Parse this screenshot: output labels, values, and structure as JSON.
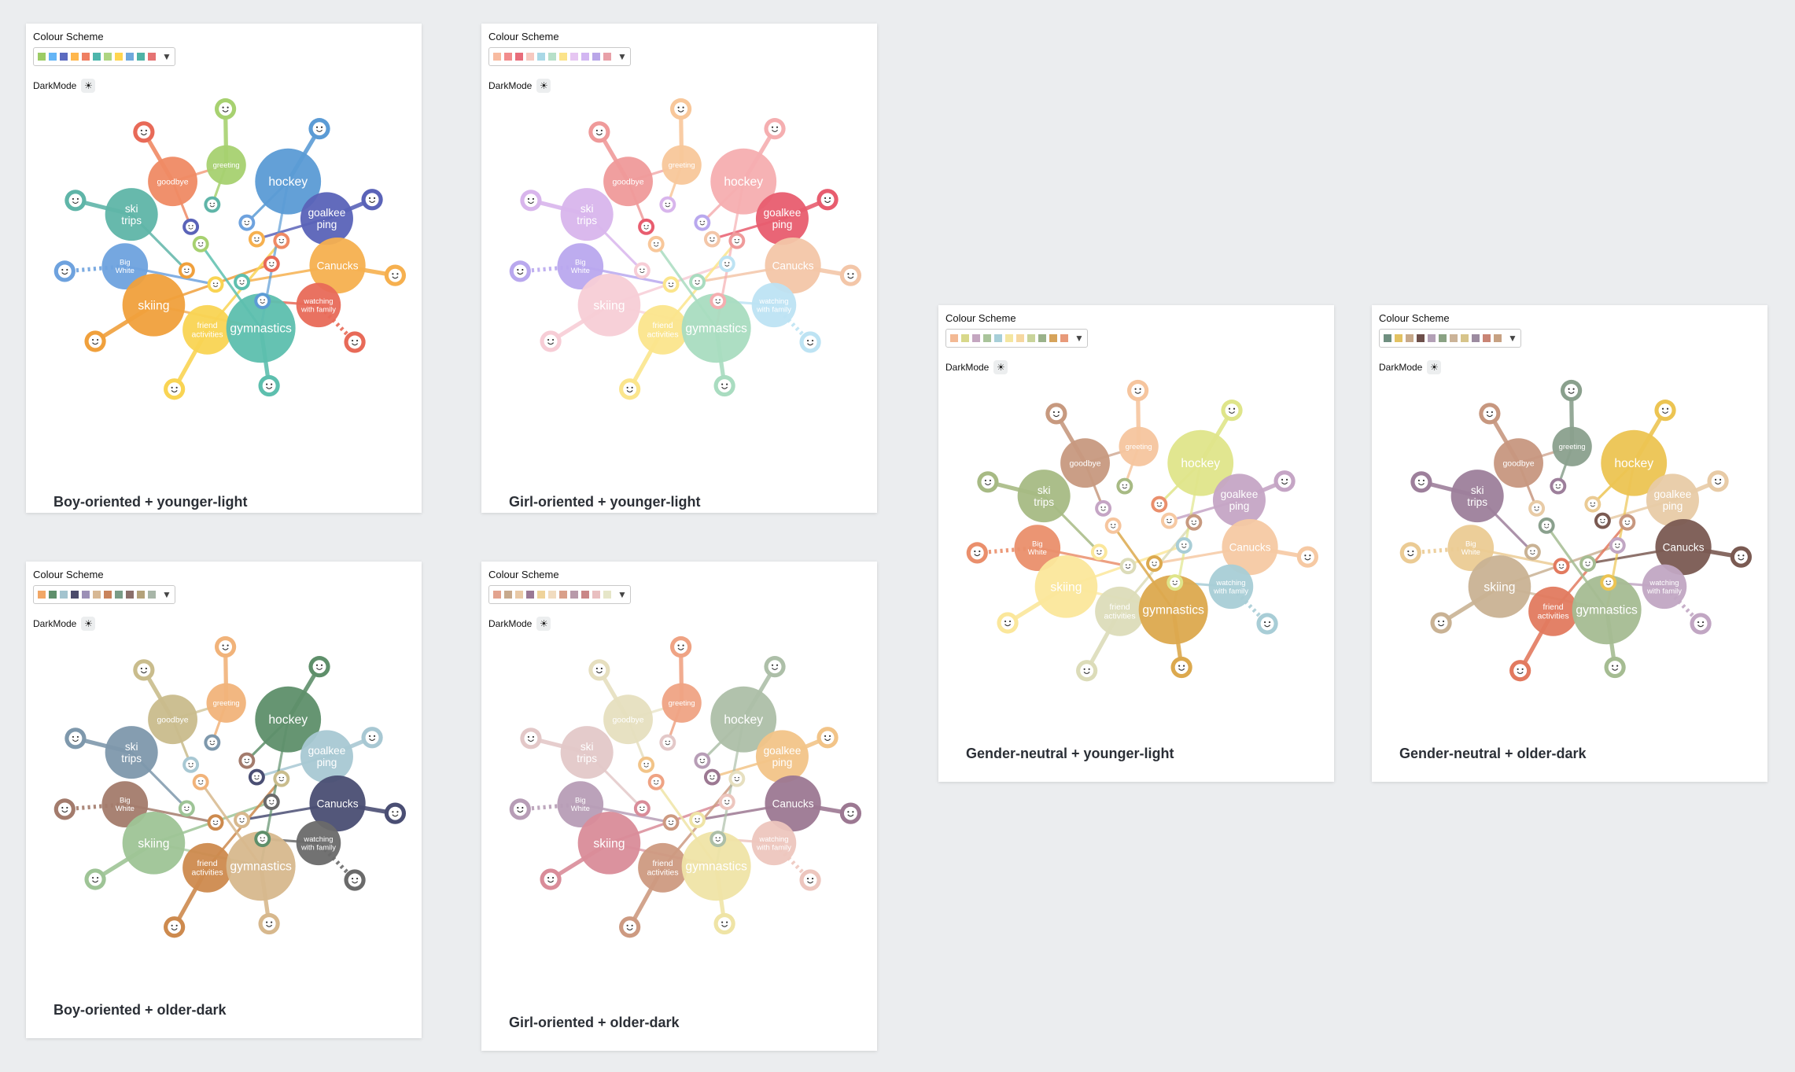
{
  "ui": {
    "colour_scheme_label": "Colour Scheme",
    "dark_mode_label": "DarkMode",
    "dropdown_arrow": "▼",
    "dark_mode_icon": "sun-icon",
    "dark_mode_glyph": "☀"
  },
  "graph": {
    "topics": [
      {
        "id": "goodbye",
        "label": "goodbye"
      },
      {
        "id": "greeting",
        "label": "greeting"
      },
      {
        "id": "hockey",
        "label": "hockey"
      },
      {
        "id": "goalkeeping",
        "label": "goalkee ping"
      },
      {
        "id": "ski_trips",
        "label": "ski trips"
      },
      {
        "id": "big_white",
        "label": "Big White"
      },
      {
        "id": "canucks",
        "label": "Canucks"
      },
      {
        "id": "skiing",
        "label": "skiing"
      },
      {
        "id": "friend_activities",
        "label": "friend activities"
      },
      {
        "id": "gymnastics",
        "label": "gymnastics"
      },
      {
        "id": "watching_with_family",
        "label": "watching with family"
      }
    ]
  },
  "panels": [
    {
      "id": "boy-younger-light",
      "caption": "Boy-oriented + younger-light",
      "swatches": [
        "#9ccc65",
        "#64b5f6",
        "#5c6bc0",
        "#ffb74d",
        "#ef7f62",
        "#4db6ac",
        "#aed581",
        "#ffd54f",
        "#6fa8dc",
        "#4fb3a6",
        "#e57373"
      ],
      "colors": {
        "goodbye": "#ef8a64",
        "greeting": "#a7d170",
        "hockey": "#5b9bd5",
        "goalkeeping": "#5a63b8",
        "ski_trips": "#5fb5a8",
        "big_white": "#6ea2de",
        "canucks": "#f6b04f",
        "skiing": "#f0a03c",
        "friend_activities": "#f9d453",
        "gymnastics": "#5dbfae",
        "watching_with_family": "#e86a58"
      },
      "leaves": [
        "#e86a58",
        "#a7d170",
        "#5b9bd5",
        "#5fb5a8",
        "#5a63b8",
        "#6ea2de",
        "#f6b04f",
        "#f0a03c",
        "#f9d453",
        "#5dbfae",
        "#e86a58"
      ]
    },
    {
      "id": "girl-younger-light",
      "caption": "Girl-oriented + younger-light",
      "swatches": [
        "#f8bba0",
        "#f28c8c",
        "#e86c7a",
        "#f6c9c0",
        "#a9d8e6",
        "#b7e0c9",
        "#fbe38a",
        "#e6c6f2",
        "#d2b6f2",
        "#b9a6e8",
        "#e8a0a8"
      ],
      "colors": {
        "goodbye": "#ef9a9a",
        "greeting": "#f8c79a",
        "hockey": "#f5aeb0",
        "goalkeeping": "#e85d6f",
        "ski_trips": "#d8b5ec",
        "big_white": "#b9a8ee",
        "canucks": "#f3c6a8",
        "skiing": "#f7cdd6",
        "friend_activities": "#fbe58c",
        "gymnastics": "#a9dcc0",
        "watching_with_family": "#bde3f3"
      },
      "leaves": [
        "#ef9a9a",
        "#f8c79a",
        "#f5aeb0",
        "#d8b5ec",
        "#e85d6f",
        "#b9a8ee",
        "#f3c6a8",
        "#f7cdd6",
        "#fbe58c",
        "#a9dcc0",
        "#bde3f3"
      ]
    },
    {
      "id": "neutral-younger-light",
      "caption": "Gender-neutral + younger-light",
      "swatches": [
        "#f3b994",
        "#d8d88a",
        "#c4a6c0",
        "#a9c49a",
        "#a7cfd8",
        "#f4e6a0",
        "#f6d7a0",
        "#c9d49a",
        "#9ab28a",
        "#d6a35a",
        "#e89a7a"
      ],
      "colors": {
        "goodbye": "#c7997f",
        "greeting": "#f6c59e",
        "hockey": "#dfe58a",
        "goalkeeping": "#c5a5c5",
        "ski_trips": "#a7ba84",
        "big_white": "#ea8f6c",
        "canucks": "#f6c9a3",
        "skiing": "#fbe79b",
        "friend_activities": "#dcdcb9",
        "gymnastics": "#dca94e",
        "watching_with_family": "#a8cdd6"
      },
      "leaves": [
        "#c7997f",
        "#f6c59e",
        "#dfe58a",
        "#a7ba84",
        "#c5a5c5",
        "#ea8f6c",
        "#f6c9a3",
        "#fbe79b",
        "#dcdcb9",
        "#dca94e",
        "#a8cdd6"
      ]
    },
    {
      "id": "neutral-older-dark",
      "caption": "Gender-neutral + older-dark",
      "swatches": [
        "#6f8f80",
        "#e3c262",
        "#c7a98a",
        "#6d4f4a",
        "#b3a0b6",
        "#8aa283",
        "#cbb398",
        "#d7c48a",
        "#9c8ba0",
        "#c98474",
        "#c7a182"
      ],
      "colors": {
        "goodbye": "#c7977f",
        "greeting": "#8aa08d",
        "hockey": "#ecc452",
        "goalkeeping": "#e8cba6",
        "ski_trips": "#9d7f9b",
        "big_white": "#ebcb94",
        "canucks": "#7a5a52",
        "skiing": "#c9b294",
        "friend_activities": "#e27a5f",
        "gymnastics": "#a5bc92",
        "watching_with_family": "#c1a6c3"
      },
      "leaves": [
        "#c7977f",
        "#8aa08d",
        "#ecc452",
        "#9d7f9b",
        "#e8cba6",
        "#ebcb94",
        "#7a5a52",
        "#c9b294",
        "#e27a5f",
        "#a5bc92",
        "#c1a6c3"
      ]
    },
    {
      "id": "boy-older-dark",
      "caption": "Boy-oriented + older-dark",
      "swatches": [
        "#f2a765",
        "#5f8f6b",
        "#a3c4cf",
        "#4a4a6a",
        "#9b8fb6",
        "#d7b894",
        "#c9835b",
        "#7a9c87",
        "#8b6f6a",
        "#b4a27a",
        "#a8b6a8"
      ],
      "colors": {
        "goodbye": "#c9bc8c",
        "greeting": "#f1b37a",
        "hockey": "#5e8f6a",
        "goalkeeping": "#a8c8d3",
        "ski_trips": "#7e98ac",
        "big_white": "#a37b6c",
        "canucks": "#4a4e73",
        "skiing": "#9ec496",
        "friend_activities": "#cd8a4e",
        "gymnastics": "#d7b88d",
        "watching_with_family": "#6a6a6a"
      },
      "leaves": [
        "#c9bc8c",
        "#f1b37a",
        "#5e8f6a",
        "#7e98ac",
        "#a8c8d3",
        "#a37b6c",
        "#4a4e73",
        "#9ec496",
        "#cd8a4e",
        "#d7b88d",
        "#6a6a6a"
      ]
    },
    {
      "id": "girl-older-dark",
      "caption": "Girl-oriented + older-dark",
      "swatches": [
        "#e3a38e",
        "#c7a98c",
        "#e9c9a6",
        "#9a7894",
        "#efd39a",
        "#f1dcc0",
        "#d9a08a",
        "#b89aaa",
        "#c98686",
        "#e9bfc0",
        "#e6e6c8"
      ],
      "colors": {
        "goodbye": "#e6dfbf",
        "greeting": "#efa384",
        "hockey": "#adbfa8",
        "goalkeeping": "#f2c488",
        "ski_trips": "#e3c8c8",
        "big_white": "#b79db6",
        "canucks": "#9c7892",
        "skiing": "#d98c99",
        "friend_activities": "#cd9a81",
        "gymnastics": "#efe4a6",
        "watching_with_family": "#edc6be"
      },
      "leaves": [
        "#e6dfbf",
        "#efa384",
        "#adbfa8",
        "#e3c8c8",
        "#f2c488",
        "#b79db6",
        "#9c7892",
        "#d98c99",
        "#cd9a81",
        "#efe4a6",
        "#edc6be"
      ]
    }
  ]
}
